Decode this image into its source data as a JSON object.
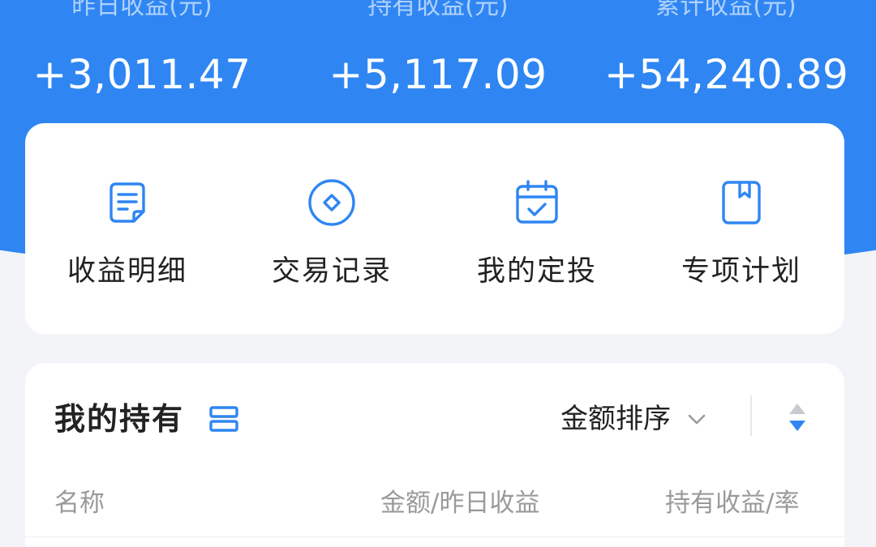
{
  "summary": {
    "items": [
      {
        "label": "昨日收益(元)",
        "value": "+3,011.47"
      },
      {
        "label": "持有收益(元)",
        "value": "+5,117.09"
      },
      {
        "label": "累计收益(元)",
        "value": "+54,240.89"
      }
    ]
  },
  "actions": [
    {
      "label": "收益明细",
      "icon": "document-icon"
    },
    {
      "label": "交易记录",
      "icon": "diamond-circle-icon"
    },
    {
      "label": "我的定投",
      "icon": "calendar-check-icon"
    },
    {
      "label": "专项计划",
      "icon": "bookmark-book-icon"
    }
  ],
  "holdings": {
    "title": "我的持有",
    "sort_label": "金额排序",
    "columns": {
      "name": "名称",
      "amount": "金额/昨日收益",
      "profit": "持有收益/率"
    }
  },
  "colors": {
    "primary": "#2f86f3",
    "icon_stroke": "#2f86f3",
    "background": "#f3f4f8"
  }
}
